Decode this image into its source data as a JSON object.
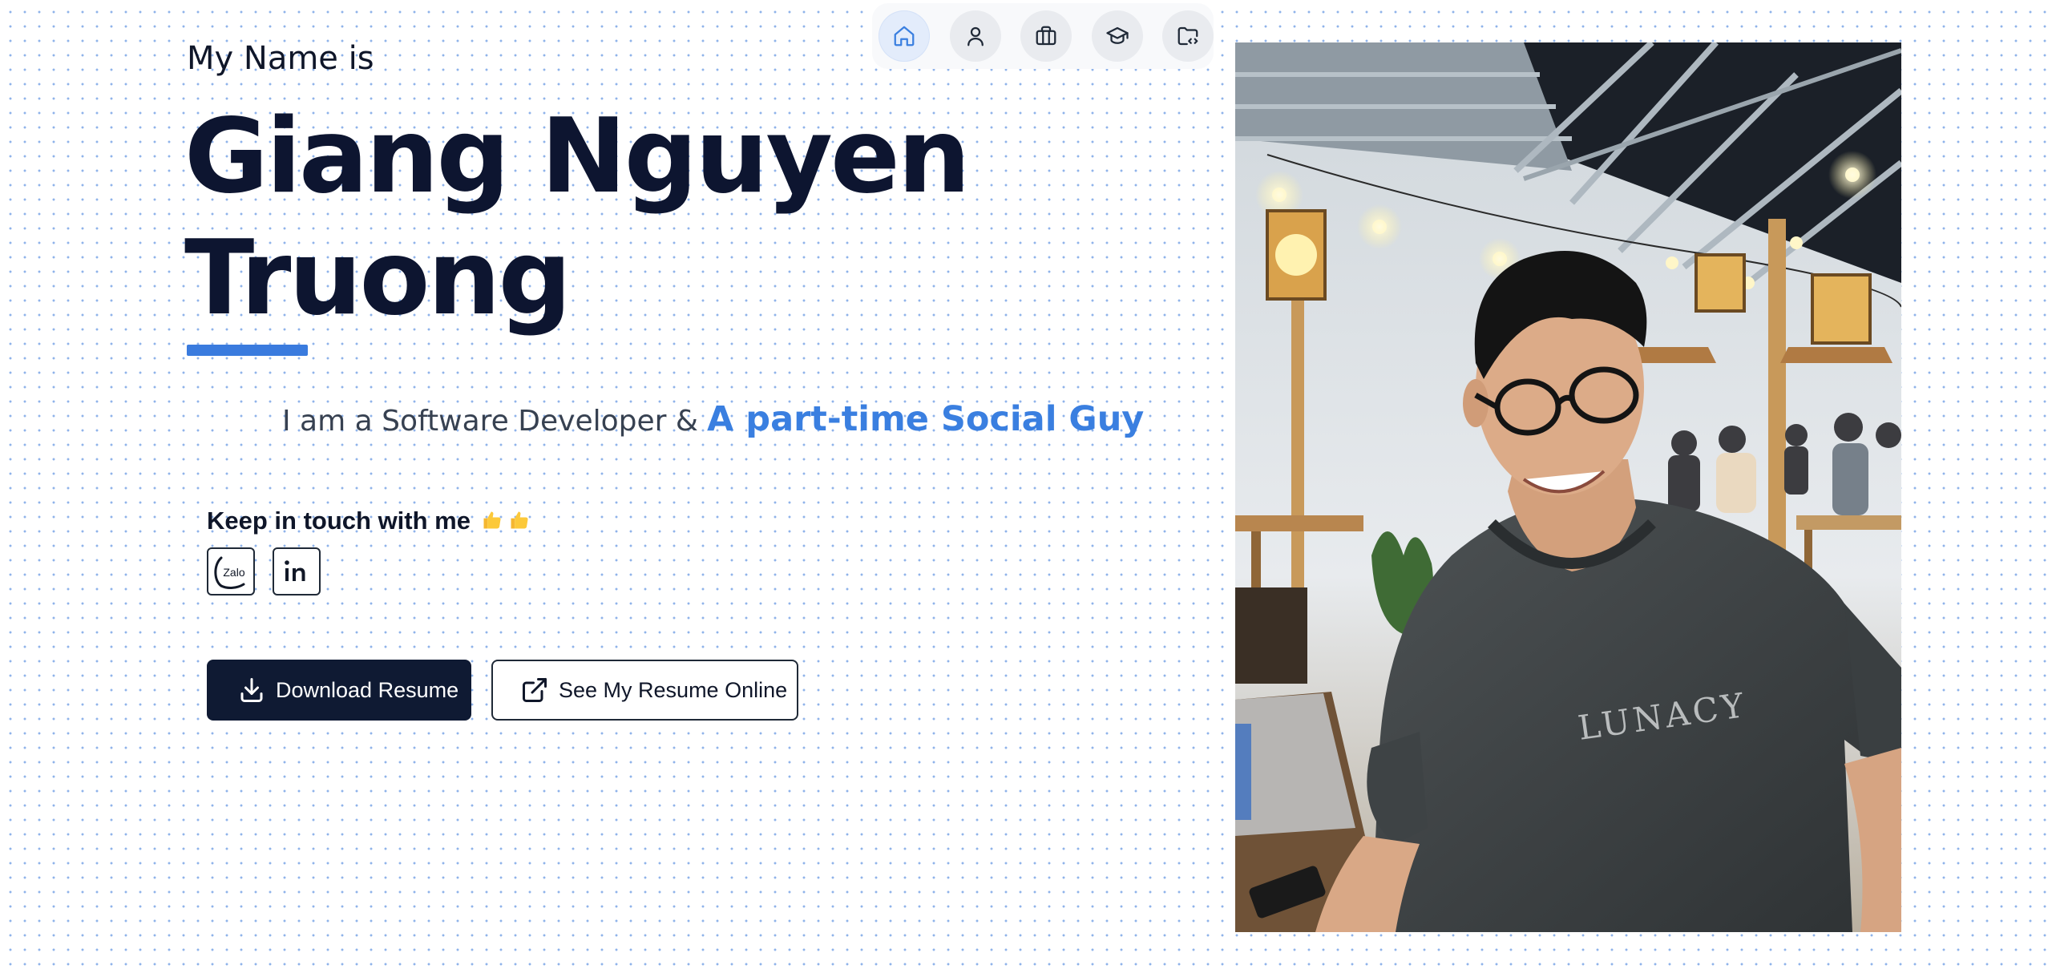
{
  "nav": {
    "items": [
      {
        "icon": "home-icon",
        "active": true
      },
      {
        "icon": "user-icon",
        "active": false
      },
      {
        "icon": "briefcase-icon",
        "active": false
      },
      {
        "icon": "graduation-cap-icon",
        "active": false
      },
      {
        "icon": "folder-code-icon",
        "active": false
      }
    ]
  },
  "hero": {
    "intro": "My Name is",
    "name": "Giang Nguyen Truong",
    "tagline_static": "I am a Software Developer &",
    "tagline_accent": "A part-time Social Guy"
  },
  "contact": {
    "title": "Keep in touch with me",
    "title_emoji": "thumbs-up-icon",
    "links": [
      {
        "icon": "zalo-icon",
        "label": "Zalo"
      },
      {
        "icon": "linkedin-icon",
        "label": "in"
      }
    ]
  },
  "actions": {
    "download_label": "Download Resume",
    "online_label": "See My Resume Online"
  },
  "photo": {
    "shirt_text": "LUNACY"
  },
  "colors": {
    "accent": "#3a7fe0",
    "dark": "#0f1a33",
    "dots": "#8fb3ea"
  }
}
